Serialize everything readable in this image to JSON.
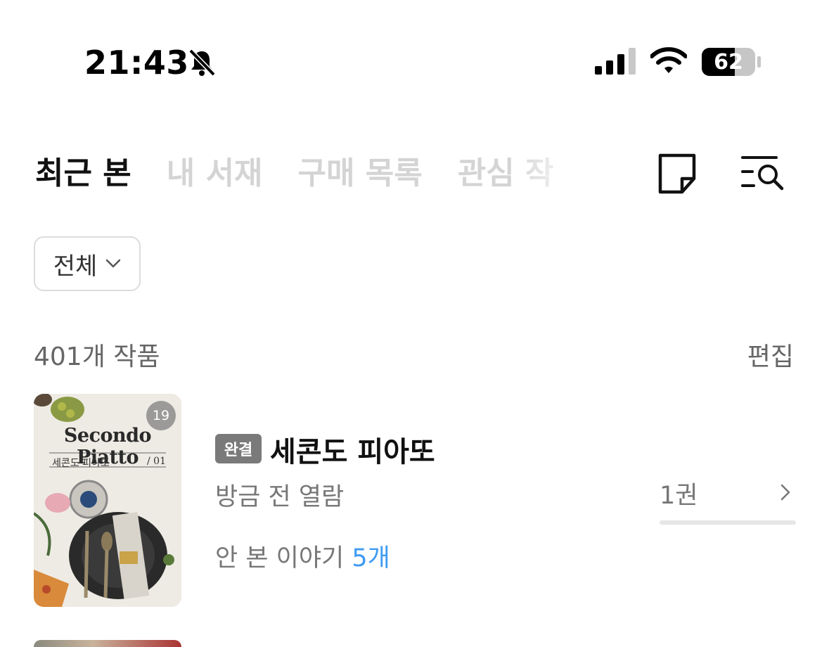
{
  "status": {
    "time": "21:43",
    "battery": "62"
  },
  "tabs": [
    {
      "label": "최근 본"
    },
    {
      "label": "내 서재"
    },
    {
      "label": "구매 목록"
    },
    {
      "label": "관심 작"
    }
  ],
  "filter": {
    "label": "전체"
  },
  "list": {
    "count": "401개 작품",
    "edit": "편집"
  },
  "item": {
    "cover_title": "Secondo Piatto",
    "cover_subtitle": "세콘도 피아또",
    "cover_number": "/ 01",
    "new_count_badge": "19",
    "status_badge": "완결",
    "title": "세콘도 피아또",
    "opened": "방금 전 열람",
    "unread_prefix": "안 본 이야기",
    "unread_count": "5개",
    "volume": "1권",
    "progress_fraction": 0.0
  },
  "colors": {
    "accent_blue": "#3d9bf0",
    "badge_gray": "#7a7a7a",
    "tab_inactive": "#d4d4d4"
  }
}
